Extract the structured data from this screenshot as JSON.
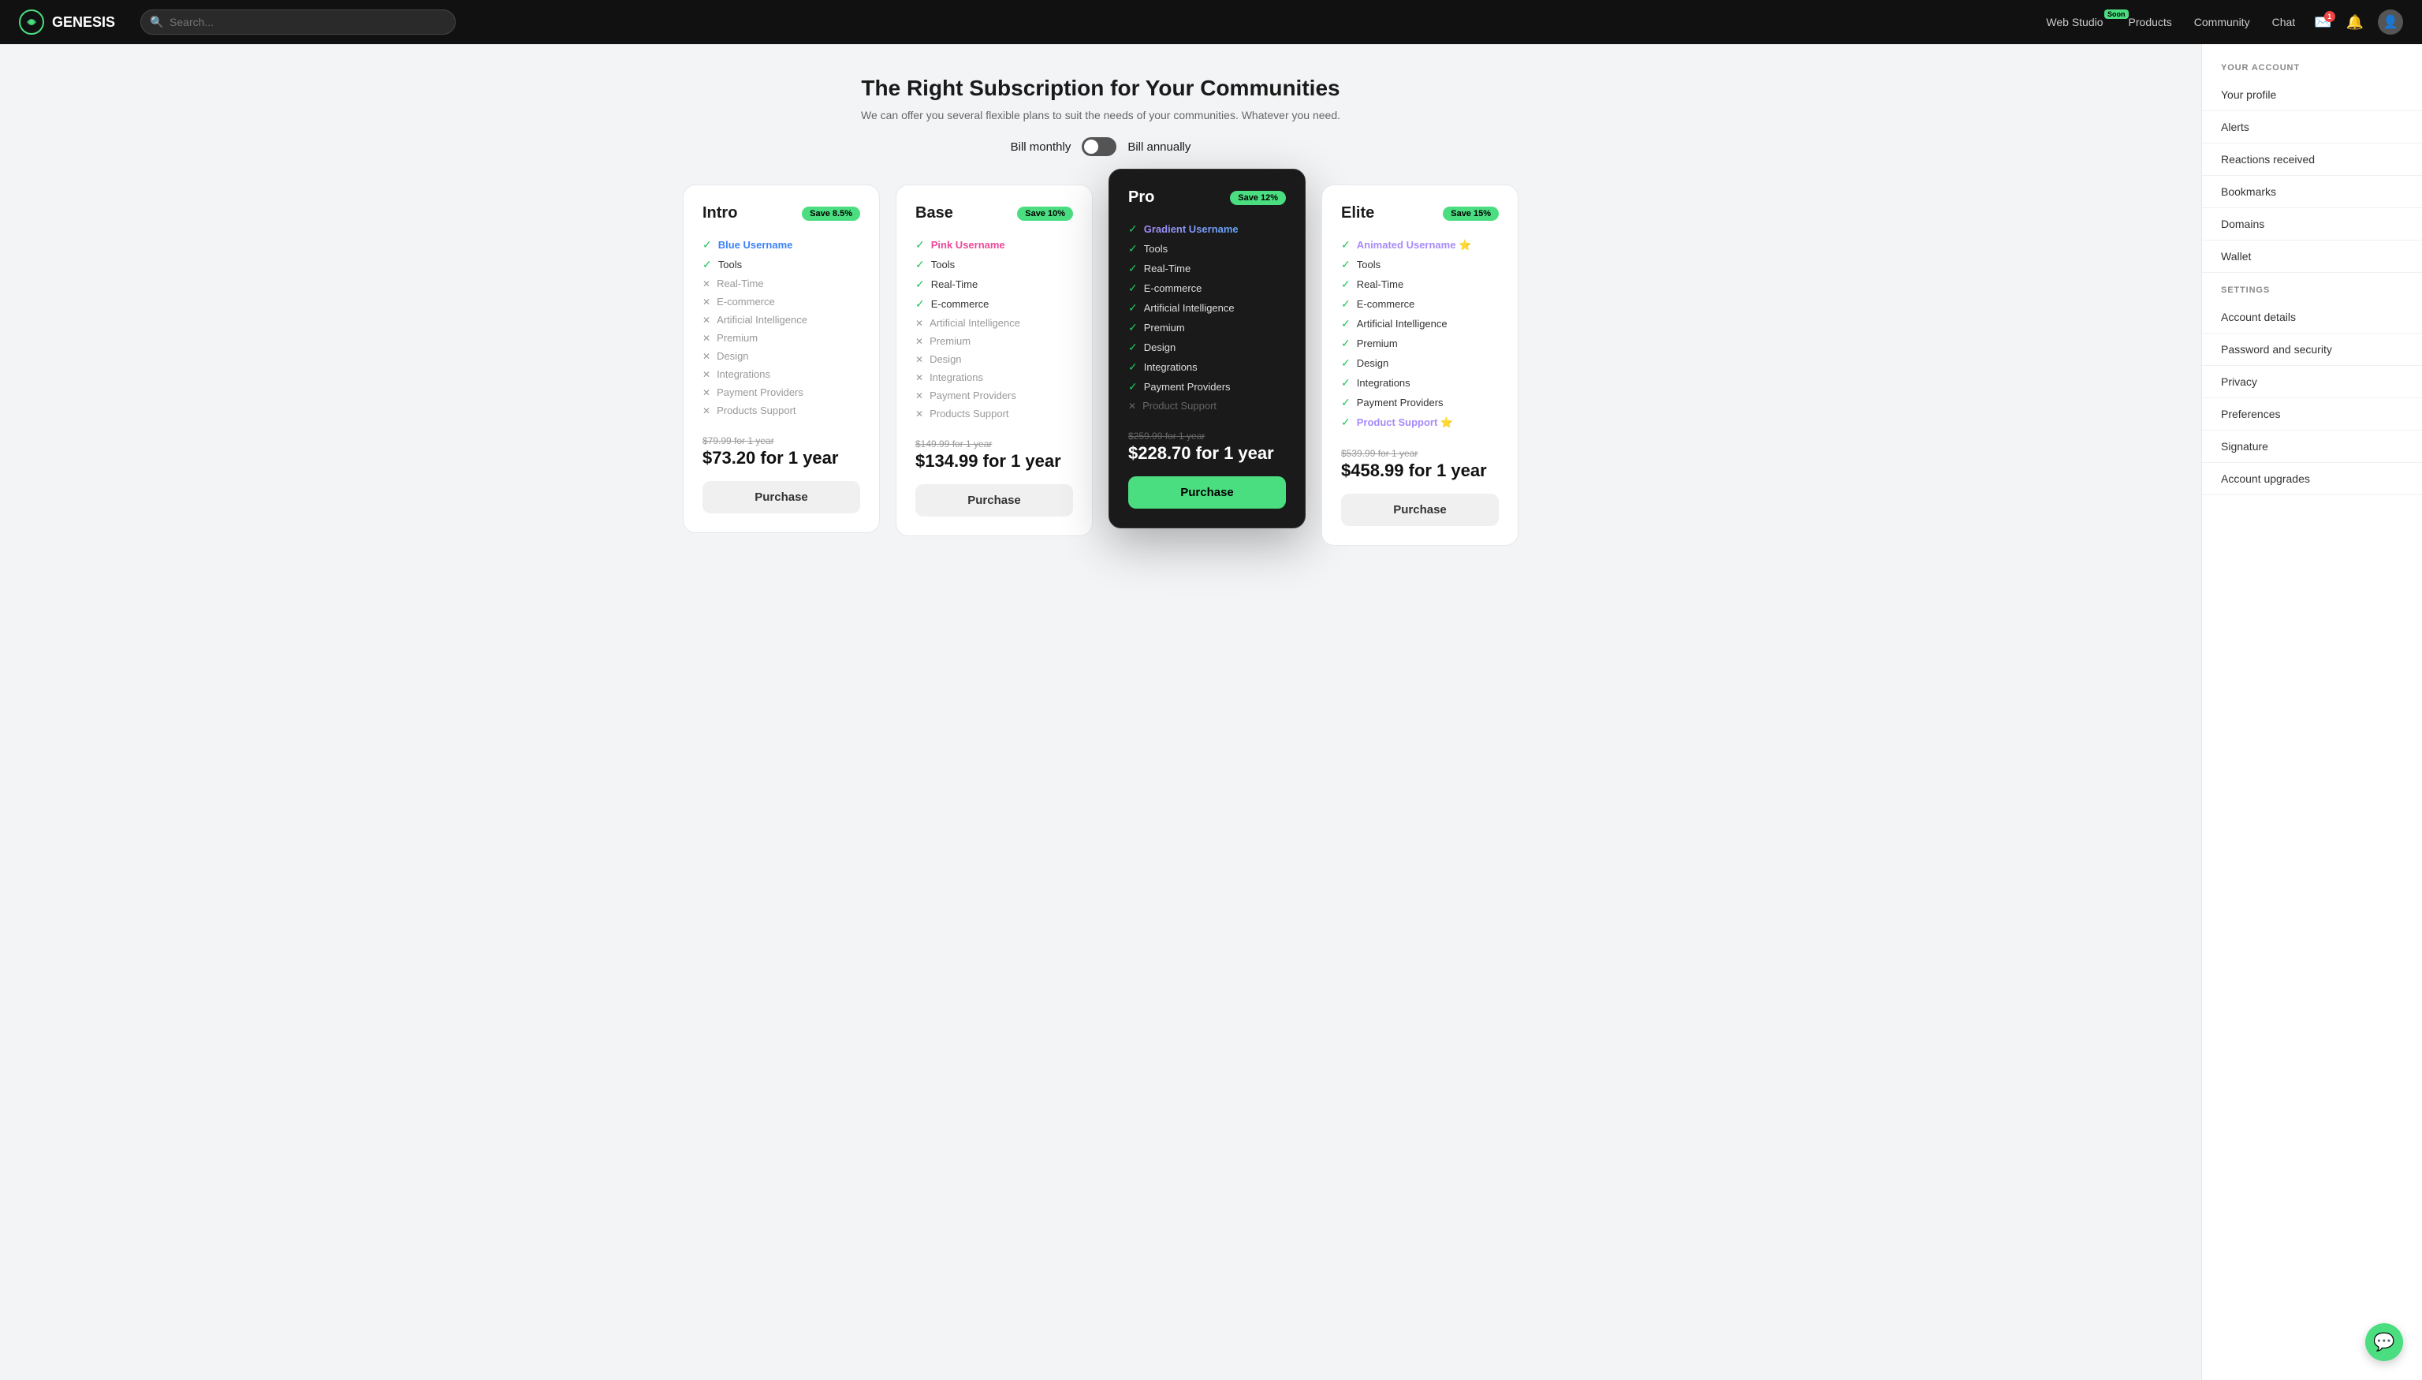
{
  "navbar": {
    "logo_text": "GENESIS",
    "search_placeholder": "Search...",
    "links": [
      {
        "label": "Web Studio",
        "soon": true
      },
      {
        "label": "Products",
        "soon": false
      },
      {
        "label": "Community",
        "soon": false
      },
      {
        "label": "Chat",
        "soon": false
      }
    ]
  },
  "page": {
    "title": "The Right Subscription for Your Communities",
    "subtitle": "We can offer you several flexible plans to suit the needs of your communities. Whatever you need.",
    "billing_monthly_label": "Bill monthly",
    "billing_annually_label": "Bill annually"
  },
  "plans": [
    {
      "id": "intro",
      "name": "Intro",
      "save_badge": "Save 8.5%",
      "featured": false,
      "features": [
        {
          "label": "Blue Username",
          "enabled": true,
          "colored": "blue"
        },
        {
          "label": "Tools",
          "enabled": true,
          "colored": null
        },
        {
          "label": "Real-Time",
          "enabled": false,
          "colored": null
        },
        {
          "label": "E-commerce",
          "enabled": false,
          "colored": null
        },
        {
          "label": "Artificial Intelligence",
          "enabled": false,
          "colored": null
        },
        {
          "label": "Premium",
          "enabled": false,
          "colored": null
        },
        {
          "label": "Design",
          "enabled": false,
          "colored": null
        },
        {
          "label": "Integrations",
          "enabled": false,
          "colored": null
        },
        {
          "label": "Payment Providers",
          "enabled": false,
          "colored": null
        },
        {
          "label": "Products Support",
          "enabled": false,
          "colored": null
        }
      ],
      "original_price": "$79.99 for 1 year",
      "current_price": "$73.20 for 1 year",
      "purchase_label": "Purchase"
    },
    {
      "id": "base",
      "name": "Base",
      "save_badge": "Save 10%",
      "featured": false,
      "features": [
        {
          "label": "Pink Username",
          "enabled": true,
          "colored": "pink"
        },
        {
          "label": "Tools",
          "enabled": true,
          "colored": null
        },
        {
          "label": "Real-Time",
          "enabled": true,
          "colored": null
        },
        {
          "label": "E-commerce",
          "enabled": true,
          "colored": null
        },
        {
          "label": "Artificial Intelligence",
          "enabled": false,
          "colored": null
        },
        {
          "label": "Premium",
          "enabled": false,
          "colored": null
        },
        {
          "label": "Design",
          "enabled": false,
          "colored": null
        },
        {
          "label": "Integrations",
          "enabled": false,
          "colored": null
        },
        {
          "label": "Payment Providers",
          "enabled": false,
          "colored": null
        },
        {
          "label": "Products Support",
          "enabled": false,
          "colored": null
        }
      ],
      "original_price": "$149.99 for 1 year",
      "current_price": "$134.99 for 1 year",
      "purchase_label": "Purchase"
    },
    {
      "id": "pro",
      "name": "Pro",
      "save_badge": "Save 12%",
      "featured": true,
      "features": [
        {
          "label": "Gradient Username",
          "enabled": true,
          "colored": "gradient"
        },
        {
          "label": "Tools",
          "enabled": true,
          "colored": null
        },
        {
          "label": "Real-Time",
          "enabled": true,
          "colored": null
        },
        {
          "label": "E-commerce",
          "enabled": true,
          "colored": null
        },
        {
          "label": "Artificial Intelligence",
          "enabled": true,
          "colored": null
        },
        {
          "label": "Premium",
          "enabled": true,
          "colored": null
        },
        {
          "label": "Design",
          "enabled": true,
          "colored": null
        },
        {
          "label": "Integrations",
          "enabled": true,
          "colored": null
        },
        {
          "label": "Payment Providers",
          "enabled": true,
          "colored": null
        },
        {
          "label": "Product Support",
          "enabled": false,
          "colored": null
        }
      ],
      "original_price": "$259.99 for 1 year",
      "current_price": "$228.70 for 1 year",
      "purchase_label": "Purchase"
    },
    {
      "id": "elite",
      "name": "Elite",
      "save_badge": "Save 15%",
      "featured": false,
      "features": [
        {
          "label": "Animated Username ⭐",
          "enabled": true,
          "colored": "purple"
        },
        {
          "label": "Tools",
          "enabled": true,
          "colored": null
        },
        {
          "label": "Real-Time",
          "enabled": true,
          "colored": null
        },
        {
          "label": "E-commerce",
          "enabled": true,
          "colored": null
        },
        {
          "label": "Artificial Intelligence",
          "enabled": true,
          "colored": null
        },
        {
          "label": "Premium",
          "enabled": true,
          "colored": null
        },
        {
          "label": "Design",
          "enabled": true,
          "colored": null
        },
        {
          "label": "Integrations",
          "enabled": true,
          "colored": null
        },
        {
          "label": "Payment Providers",
          "enabled": true,
          "colored": null
        },
        {
          "label": "Product Support ⭐",
          "enabled": true,
          "colored": "purple"
        }
      ],
      "original_price": "$539.99 for 1 year",
      "current_price": "$458.99 for 1 year",
      "purchase_label": "Purchase"
    }
  ],
  "sidebar": {
    "account_section_label": "YOUR ACCOUNT",
    "account_items": [
      "Your profile",
      "Alerts",
      "Reactions received",
      "Bookmarks",
      "Domains",
      "Wallet"
    ],
    "settings_section_label": "SETTINGS",
    "settings_items": [
      "Account details",
      "Password and security",
      "Privacy",
      "Preferences",
      "Signature",
      "Account upgrades"
    ]
  },
  "chat_bubble_icon": "💬"
}
